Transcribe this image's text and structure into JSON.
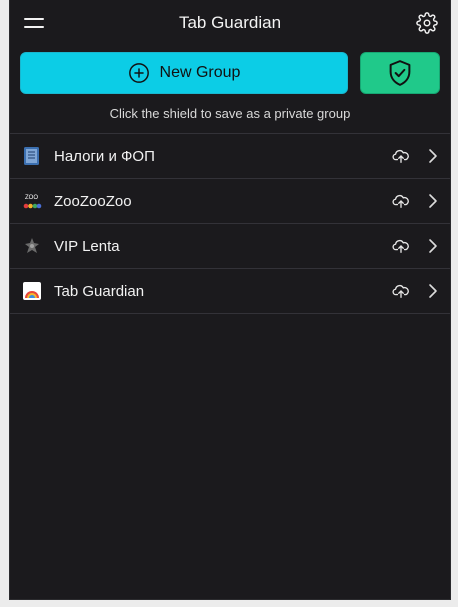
{
  "header": {
    "title": "Tab Guardian"
  },
  "actions": {
    "new_group_label": "New Group",
    "hint": "Click the shield to save as a private group"
  },
  "groups": [
    {
      "label": "Налоги и ФОП",
      "icon": "document-icon"
    },
    {
      "label": "ZooZooZoo",
      "icon": "zoo-logo-icon"
    },
    {
      "label": "VIP Lenta",
      "icon": "vip-lenta-icon"
    },
    {
      "label": "Tab Guardian",
      "icon": "tab-guardian-icon"
    }
  ],
  "favicon_text": {
    "zoo": "ZOO"
  },
  "colors": {
    "background": "#1b1a1d",
    "new_group_button": "#0ccde6",
    "shield_button": "#20c98a",
    "divider": "#333238"
  }
}
